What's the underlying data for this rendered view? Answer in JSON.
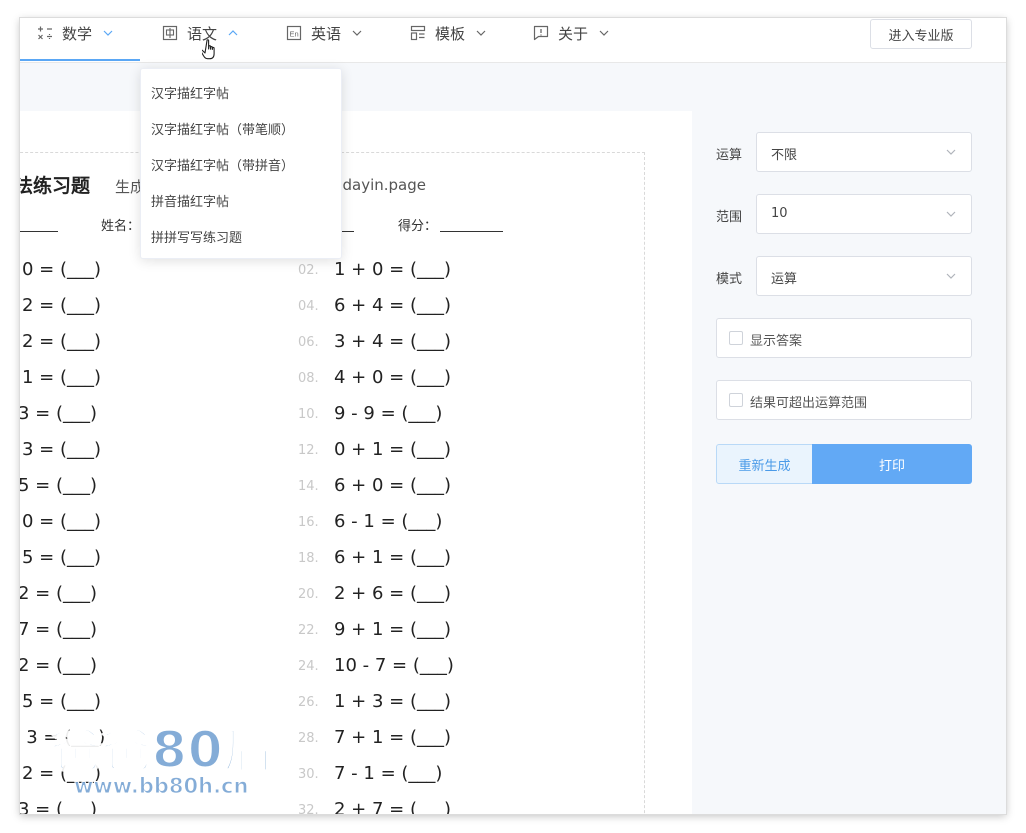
{
  "nav": {
    "items": [
      {
        "label": "数学",
        "icon": "math-ops-icon"
      },
      {
        "label": "语文",
        "icon": "chinese-char-icon"
      },
      {
        "label": "英语",
        "icon": "english-en-icon"
      },
      {
        "label": "模板",
        "icon": "template-icon"
      },
      {
        "label": "关于",
        "icon": "about-chat-icon"
      }
    ],
    "pro_button": "进入专业版"
  },
  "dropdown": {
    "items": [
      "汉字描红字帖",
      "汉字描红字帖（带笔顺）",
      "汉字描红字帖（带拼音）",
      "拼音描红字帖",
      "拼拼写写练习题"
    ]
  },
  "sheet": {
    "title": "法练习题",
    "subtitle": "生成",
    "url": "v.dayin.page",
    "name_label": "姓名：",
    "score_label": "得分："
  },
  "left_questions": [
    "0 = (___)",
    "2 = (___)",
    "2 = (___)",
    "1 = (___)",
    "3 = (___)",
    "3 = (___)",
    "5 = (___)",
    "0 = (___)",
    "5 = (___)",
    "2 = (___)",
    "7 = (___)",
    "2 = (___)",
    "5 = (___)",
    "- 3 = (___)",
    "2 = (___)",
    "3 = (___)"
  ],
  "right_questions": [
    {
      "num": "02.",
      "expr": "1 + 0 = (___)"
    },
    {
      "num": "04.",
      "expr": "6 + 4 = (___)"
    },
    {
      "num": "06.",
      "expr": "3 + 4 = (___)"
    },
    {
      "num": "08.",
      "expr": "4 + 0 = (___)"
    },
    {
      "num": "10.",
      "expr": "9 - 9 = (___)"
    },
    {
      "num": "12.",
      "expr": "0 + 1 = (___)"
    },
    {
      "num": "14.",
      "expr": "6 + 0 = (___)"
    },
    {
      "num": "16.",
      "expr": "6 - 1 = (___)"
    },
    {
      "num": "18.",
      "expr": "6 + 1 = (___)"
    },
    {
      "num": "20.",
      "expr": "2 + 6 = (___)"
    },
    {
      "num": "22.",
      "expr": "9 + 1 = (___)"
    },
    {
      "num": "24.",
      "expr": "10 - 7 = (___)"
    },
    {
      "num": "26.",
      "expr": "1 + 3 = (___)"
    },
    {
      "num": "28.",
      "expr": "7 + 1 = (___)"
    },
    {
      "num": "30.",
      "expr": "7 - 1 = (___)"
    },
    {
      "num": "32.",
      "expr": "2 + 7 = (___)"
    }
  ],
  "settings": {
    "operation": {
      "label": "运算",
      "value": "不限"
    },
    "range": {
      "label": "范围",
      "value": "10"
    },
    "mode": {
      "label": "模式",
      "value": "运算"
    },
    "show_answers": "显示答案",
    "allow_overflow": "结果可超出运算范围",
    "regenerate": "重新生成",
    "print": "打印"
  },
  "watermark": {
    "main": "爸爸80后",
    "sub": "www.bb80h.cn"
  },
  "colors": {
    "accent": "#62a9f5",
    "panel_bg": "#f6f8fb",
    "regen_bg": "#eaf4fd"
  }
}
